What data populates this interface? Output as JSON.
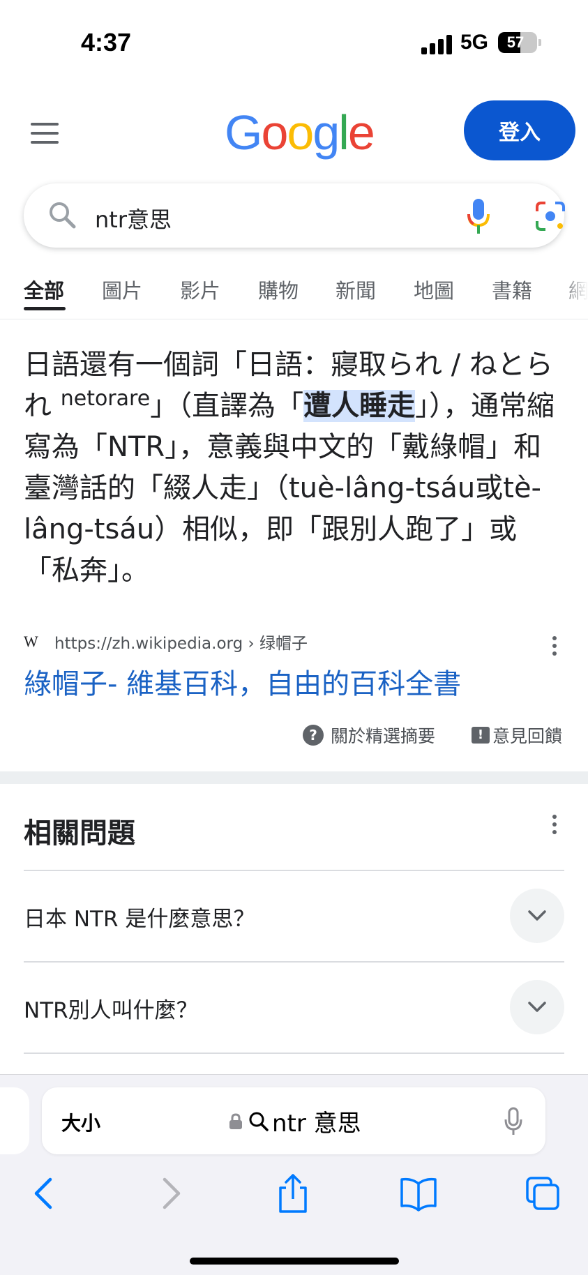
{
  "status_bar": {
    "time": "4:37",
    "network": "5G",
    "battery_level": "57"
  },
  "header": {
    "menu_icon": "hamburger-icon",
    "logo_letters": [
      {
        "ch": "G",
        "color": "#4285f4"
      },
      {
        "ch": "o",
        "color": "#ea4335"
      },
      {
        "ch": "o",
        "color": "#fbbc05"
      },
      {
        "ch": "g",
        "color": "#4285f4"
      },
      {
        "ch": "l",
        "color": "#34a853"
      },
      {
        "ch": "e",
        "color": "#ea4335"
      }
    ],
    "signin_label": "登入"
  },
  "search": {
    "query": "ntr意思",
    "icons": [
      "search-icon",
      "mic-icon",
      "lens-icon"
    ]
  },
  "tabs": [
    "全部",
    "圖片",
    "影片",
    "購物",
    "新聞",
    "地圖",
    "書籍",
    "網"
  ],
  "snippet": {
    "part1": "日語還有一個詞「日語：寢取られ / ねとられ",
    "sup": "netorare",
    "part2": "」（直譯為「",
    "highlight": "遭人睡走",
    "part3": "」），通常縮寫為「NTR」，意義與中文的「戴綠帽」和臺灣話的「綴人走」（tuè-lâng-tsáu或tè-lâng-tsáu）相似，即「跟別人跑了」或「私奔」。"
  },
  "source": {
    "icon": "W",
    "url": "https://zh.wikipedia.org › 绿帽子"
  },
  "result_title": "綠帽子- 維基百科，自由的百科全書",
  "about_label": "關於精選摘要",
  "feedback_label": "意見回饋",
  "related": {
    "title": "相關問題",
    "questions": [
      "日本 NTR 是什麼意思？",
      "NTR別人叫什麼？"
    ]
  },
  "safari": {
    "text_size_label": "大小",
    "address": "ntr 意思"
  },
  "colors": {
    "link": "#1a62c4",
    "accent": "#0b57d0",
    "highlight": "#d3e3fd"
  }
}
